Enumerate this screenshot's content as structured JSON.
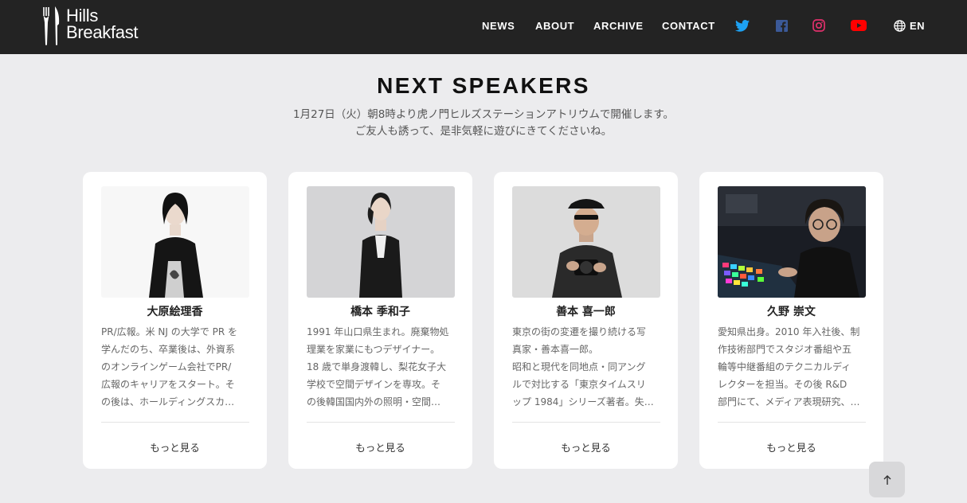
{
  "brand": {
    "line1": "Hills",
    "line2": "Breakfast"
  },
  "nav": {
    "items": [
      {
        "label": "NEWS"
      },
      {
        "label": "ABOUT"
      },
      {
        "label": "ARCHIVE"
      },
      {
        "label": "CONTACT"
      }
    ],
    "social": [
      {
        "icon": "twitter-icon",
        "color": "#1da1f2"
      },
      {
        "icon": "facebook-icon",
        "color": "#3b5998"
      },
      {
        "icon": "instagram-icon",
        "color": "#e1306c"
      },
      {
        "icon": "youtube-icon",
        "color": "#ff0000"
      }
    ],
    "lang": "EN"
  },
  "section": {
    "title": "NEXT SPEAKERS",
    "intro_line1": "1月27日（火）朝8時より虎ノ門ヒルズステーションアトリウムで開催します。",
    "intro_line2": "ご友人も誘って、是非気軽に遊びにきてくださいね。"
  },
  "speakers": [
    {
      "name": "大原絵理香",
      "bio": [
        "PR/広報。米 NJ の大学で PR を",
        "学んだのち、卒業後は、外資系",
        "のオンラインゲーム会社でPR/",
        "広報のキャリアをスタート。そ",
        "の後は、ホールディングスカ…"
      ],
      "more": "もっと見る"
    },
    {
      "name": "橋本 季和子",
      "bio": [
        "1991 年山口県生まれ。廃棄物処",
        "理業を家業にもつデザイナー。",
        "18 歳で単身渡韓し、梨花女子大",
        "学校で空間デザインを専攻。そ",
        "の後韓国国内外の照明・空間…"
      ],
      "more": "もっと見る"
    },
    {
      "name": "善本 喜一郎",
      "bio": [
        "東京の街の変遷を撮り続ける写",
        "真家・善本喜一郎。",
        "昭和と現代を同地点・同アング",
        "ルで対比する「東京タイムスリ",
        "ップ 1984」シリーズ著者。失…"
      ],
      "more": "もっと見る"
    },
    {
      "name": "久野 崇文",
      "bio": [
        "愛知県出身。2010 年入社後、制",
        "作技術部門でスタジオ番組や五",
        "輪等中継番組のテクニカルディ",
        "レクターを担当。その後 R&D",
        "部門にて、メディア表現研究、…"
      ],
      "more": "もっと見る"
    }
  ]
}
